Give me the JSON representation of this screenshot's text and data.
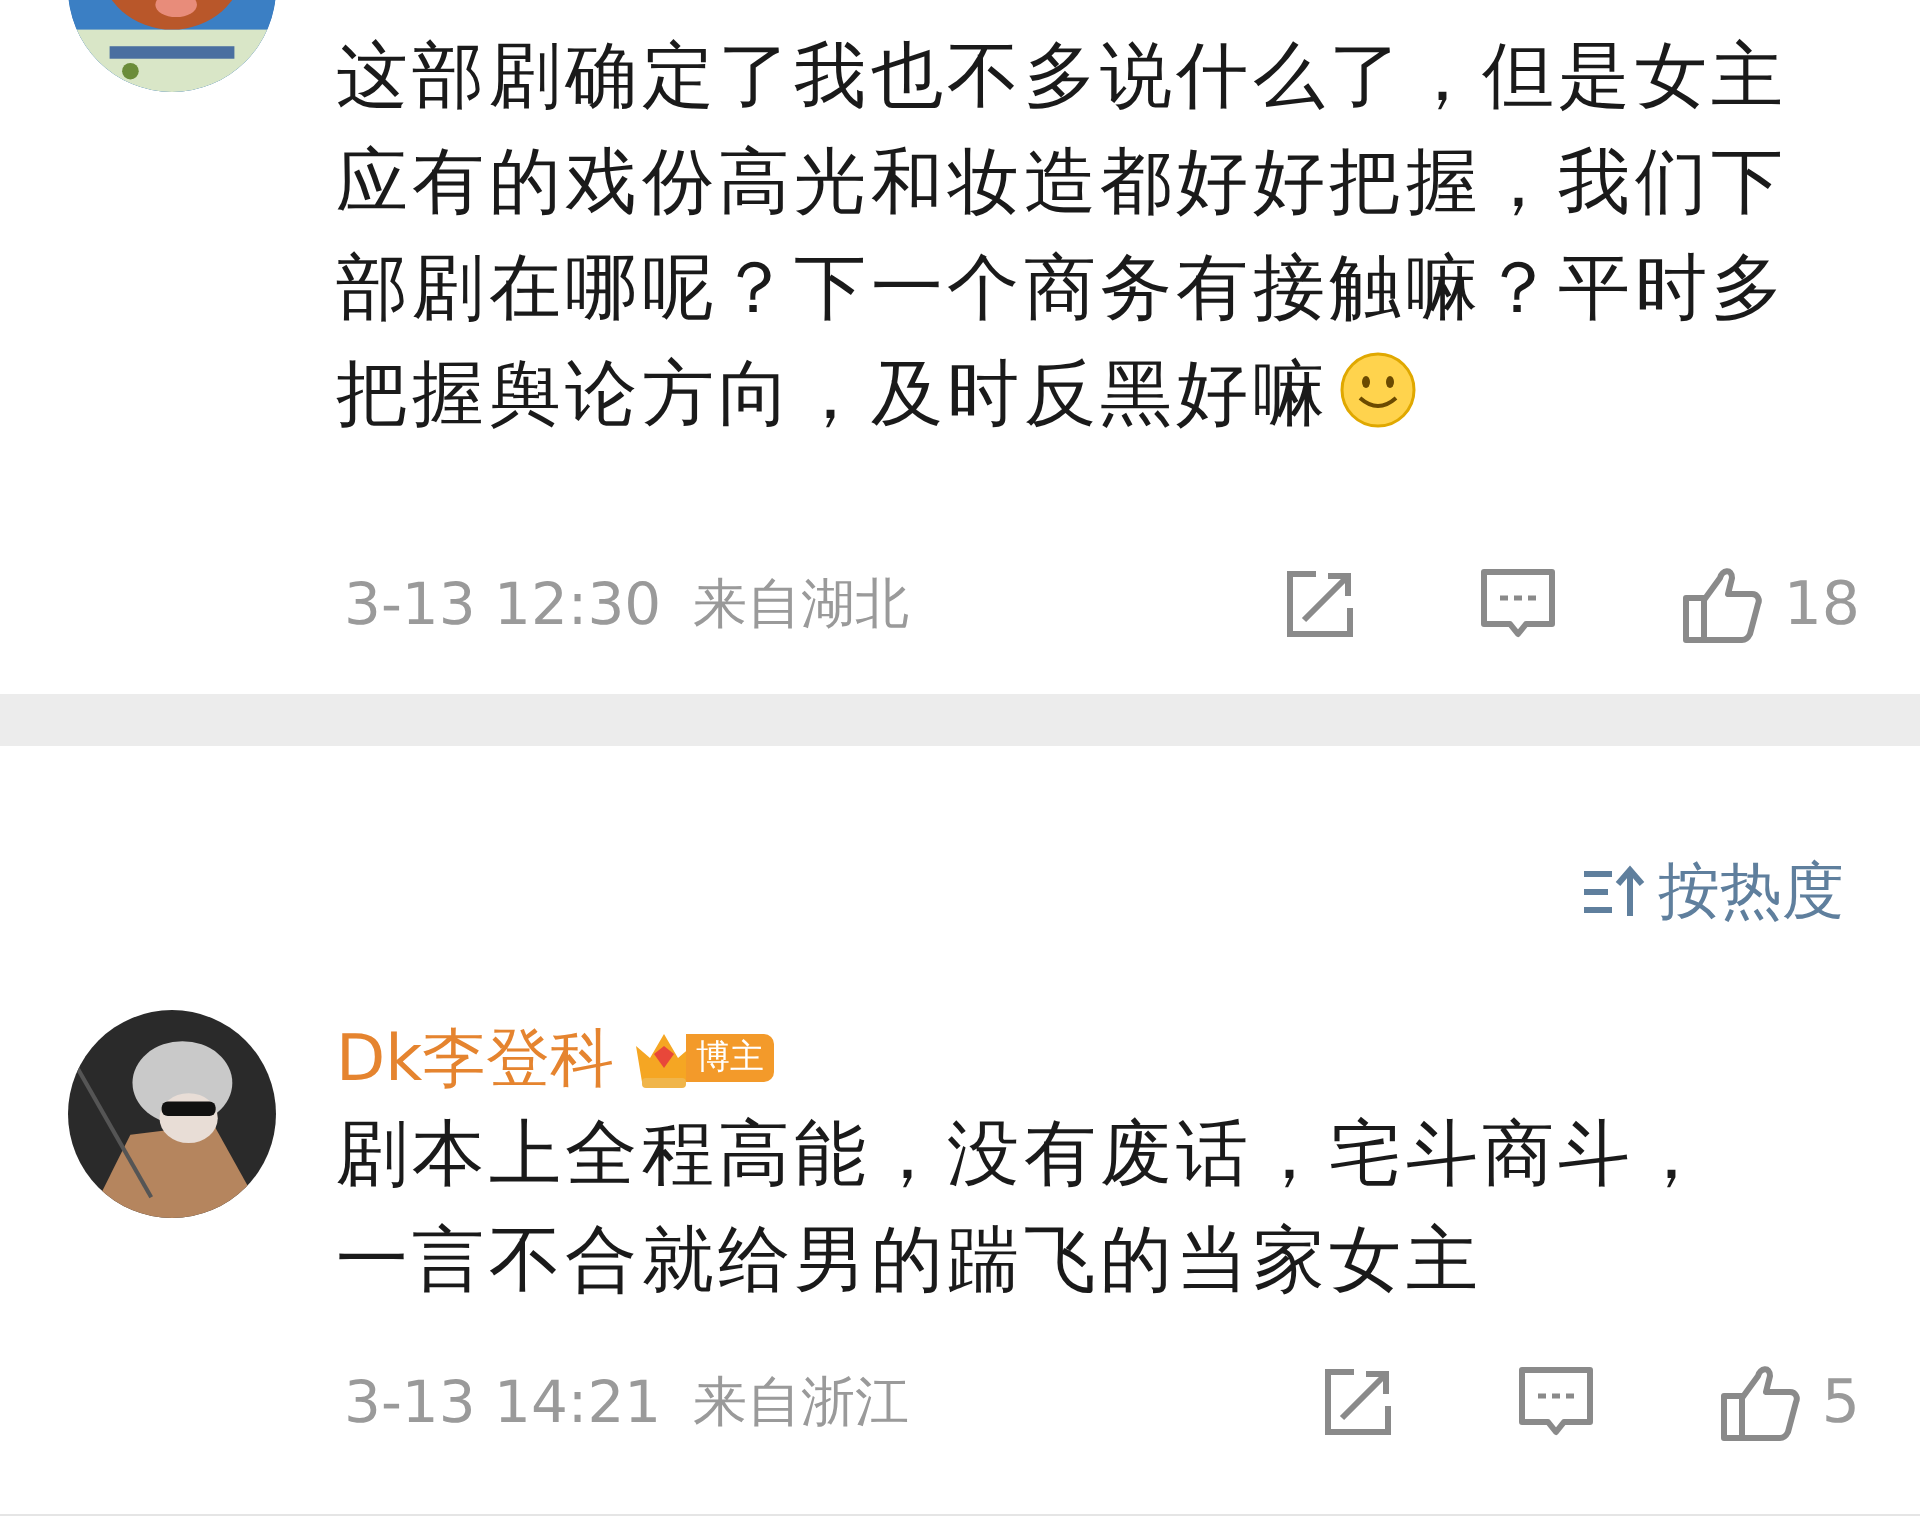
{
  "comments": [
    {
      "text_lines": [
        "这部剧确定了我也不多说什么了，但是女主",
        "应有的戏份高光和妆造都好好把握，我们下",
        "部剧在哪呢？下一个商务有接触嘛？平时多",
        "把握舆论方向，及时反黑好嘛"
      ],
      "emoji": true,
      "time": "3-13 12:30",
      "location": "来自湖北",
      "likes": "18",
      "liked": false
    },
    {
      "author": "Dk李登科",
      "badge": "博主",
      "text_lines": [
        "剧本上全程高能，没有废话，宅斗商斗，",
        "一言不合就给男的踹飞的当家女主"
      ],
      "emoji": false,
      "time": "3-13 14:21",
      "location": "来自浙江",
      "likes": "5",
      "liked": false
    }
  ],
  "sort": {
    "label": "按热度"
  }
}
